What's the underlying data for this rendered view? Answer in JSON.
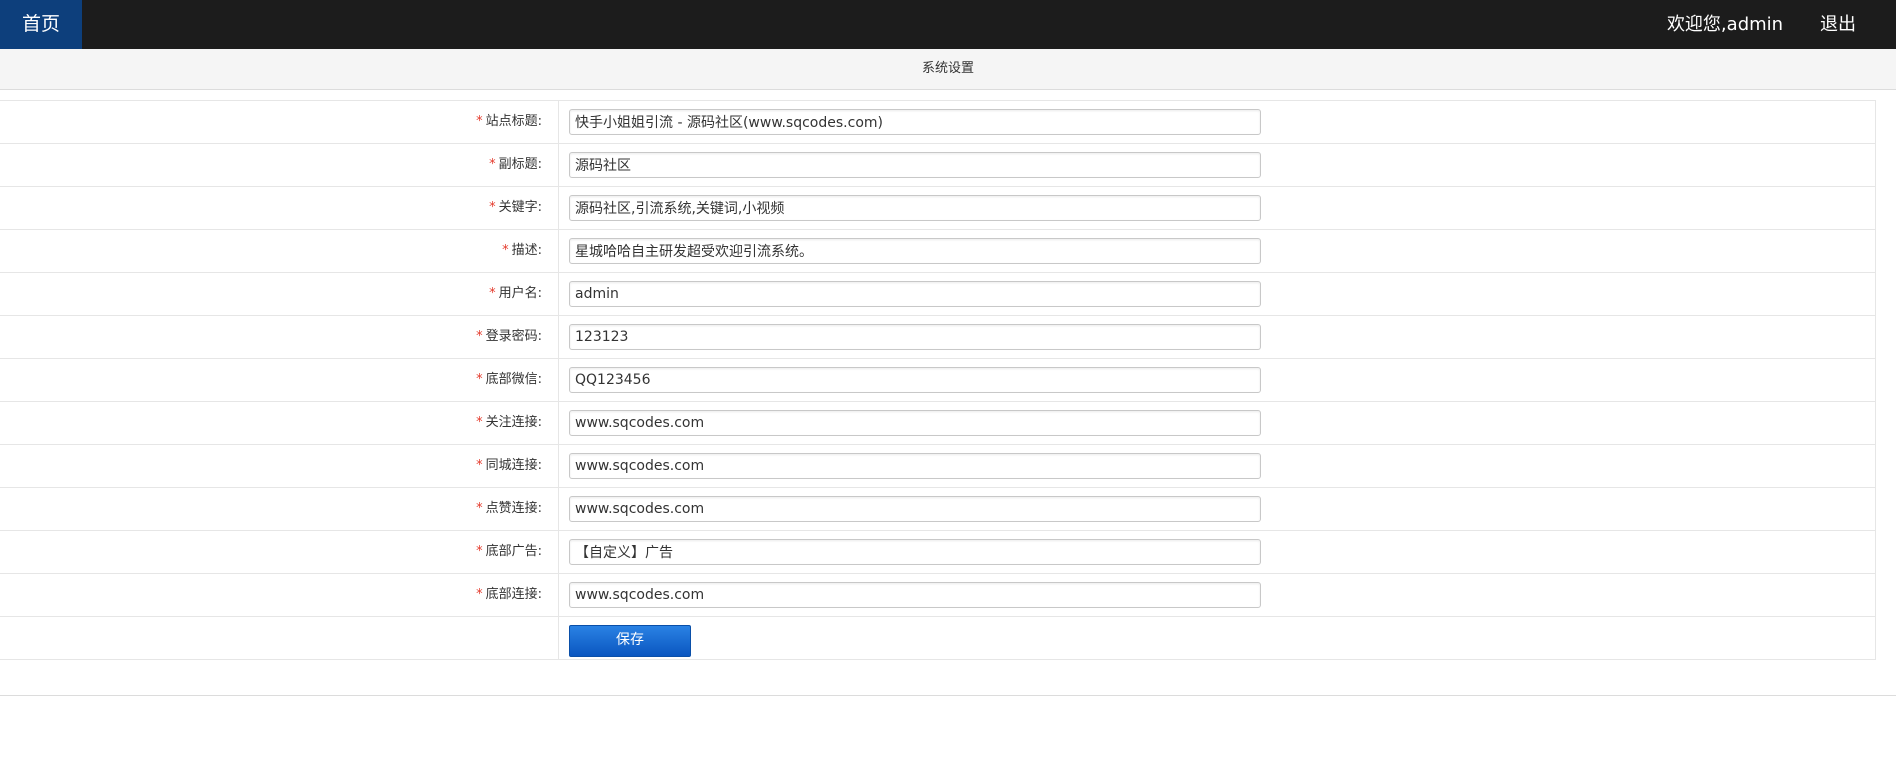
{
  "topbar": {
    "home_label": "首页",
    "welcome_text": "欢迎您,admin",
    "logout_label": "退出"
  },
  "page": {
    "title": "系统设置"
  },
  "form": {
    "required_mark": "*",
    "rows": [
      {
        "label": "站点标题:",
        "value": "快手小姐姐引流 - 源码社区(www.sqcodes.com)"
      },
      {
        "label": "副标题:",
        "value": "源码社区"
      },
      {
        "label": "关键字:",
        "value": "源码社区,引流系统,关键词,小视频"
      },
      {
        "label": "描述:",
        "value": "星城哈哈自主研发超受欢迎引流系统。"
      },
      {
        "label": "用户名:",
        "value": "admin"
      },
      {
        "label": "登录密码:",
        "value": "123123"
      },
      {
        "label": "底部微信:",
        "value": "QQ123456"
      },
      {
        "label": "关注连接:",
        "value": "www.sqcodes.com"
      },
      {
        "label": "同城连接:",
        "value": "www.sqcodes.com"
      },
      {
        "label": "点赞连接:",
        "value": "www.sqcodes.com"
      },
      {
        "label": "底部广告:",
        "value": "【自定义】广告"
      },
      {
        "label": "底部连接:",
        "value": "www.sqcodes.com"
      }
    ],
    "save_label": "保存"
  },
  "colors": {
    "topbar_bg": "#1c1c1c",
    "home_bg": "#0d3f7c",
    "required": "#e4392b",
    "button": "#0a56c0"
  }
}
